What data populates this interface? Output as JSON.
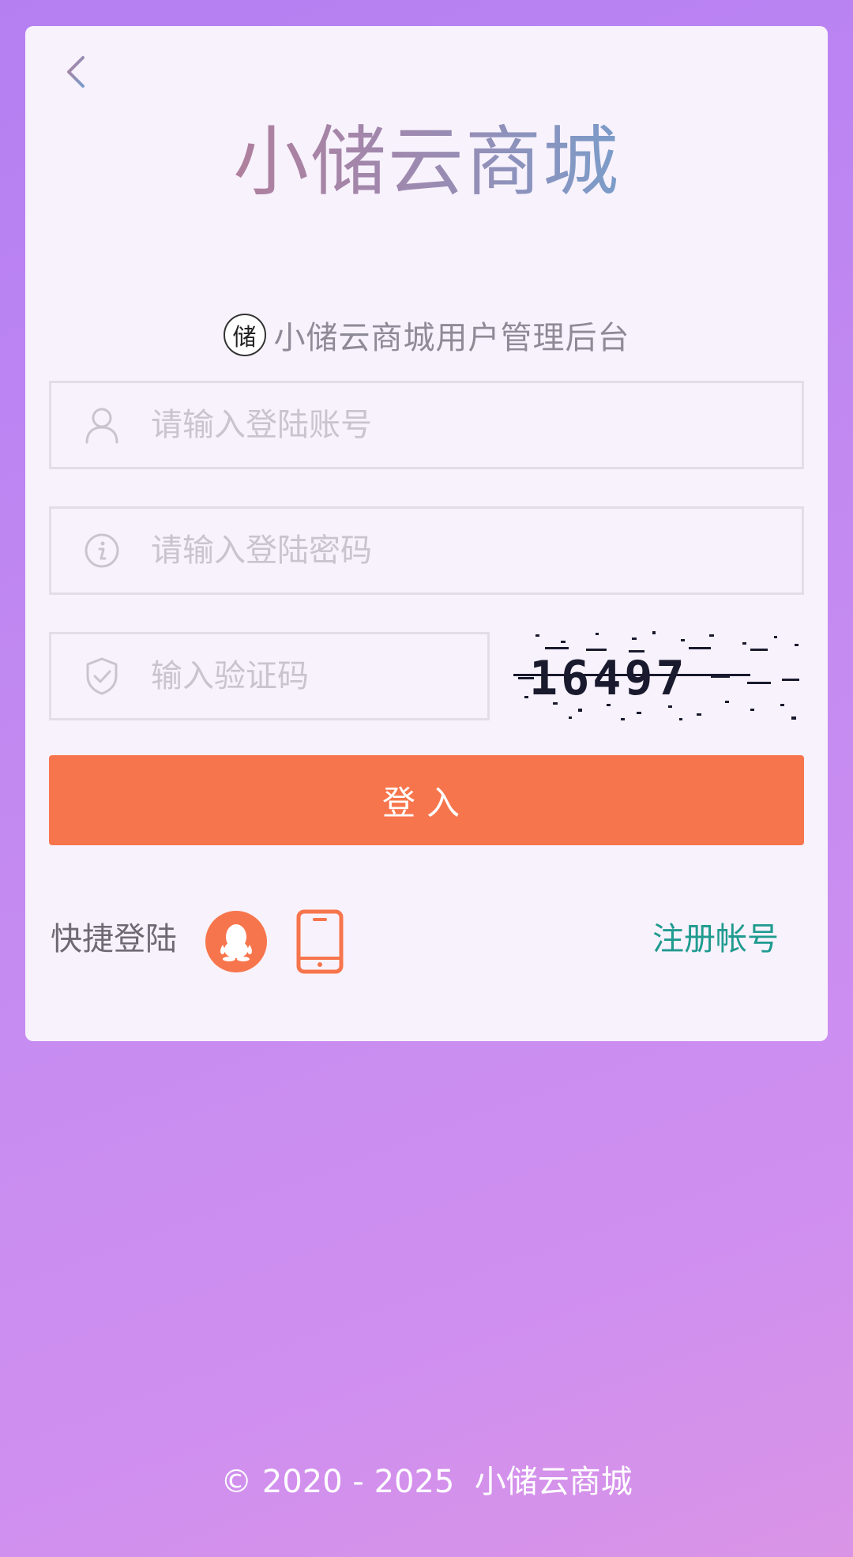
{
  "header": {
    "brand_title": "小储云商城",
    "subtitle": "小储云商城用户管理后台",
    "logo_char": "储"
  },
  "form": {
    "account_placeholder": "请输入登陆账号",
    "password_placeholder": "请输入登陆密码",
    "captcha_placeholder": "输入验证码",
    "captcha_text": "16497",
    "login_label": "登入"
  },
  "quick": {
    "label": "快捷登陆",
    "register_label": "注册帐号"
  },
  "footer": {
    "copyright": "© 2020 - 2025",
    "site_name": "小储云商城"
  },
  "colors": {
    "accent": "#f7754c",
    "link": "#1f9b8f",
    "card": "#f8f2fc"
  },
  "icons": {
    "back": "chevron-left-icon",
    "user": "user-icon",
    "password": "info-circle-icon",
    "captcha": "shield-check-icon",
    "qq": "qq-icon",
    "phone": "phone-icon"
  }
}
